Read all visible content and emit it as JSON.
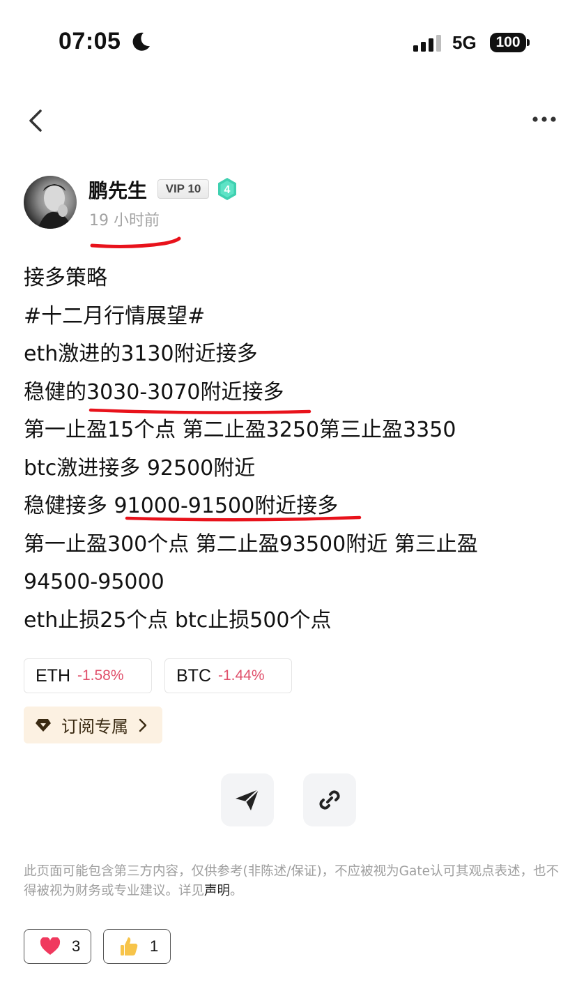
{
  "status_bar": {
    "time": "07:05",
    "network": "5G",
    "battery": "100"
  },
  "nav": {
    "back_icon": "chevron-left-icon",
    "more_icon": "more-horizontal-icon"
  },
  "author": {
    "name": "鹏先生",
    "vip": "VIP 10",
    "level": "4",
    "time_ago": "19 小时前"
  },
  "post": {
    "lines": [
      "接多策略",
      "#十二月行情展望#",
      "eth激进的3130附近接多",
      "稳健的3030-3070附近接多",
      "第一止盈15个点 第二止盈3250第三止盈3350",
      "btc激进接多 92500附近",
      "稳健接多 91000-91500附近接多",
      "第一止盈300个点 第二止盈93500附近 第三止盈",
      "94500-95000",
      "eth止损25个点 btc止损500个点"
    ]
  },
  "coins": [
    {
      "symbol": "ETH",
      "change": "-1.58%"
    },
    {
      "symbol": "BTC",
      "change": "-1.44%"
    }
  ],
  "subscribe": {
    "label": "订阅专属"
  },
  "actions": {
    "share_icon": "send-icon",
    "link_icon": "link-icon"
  },
  "disclaimer": {
    "text": "此页面可能包含第三方内容，仅供参考(非陈述/保证)，不应被视为Gate认可其观点表述，也不得被视为财务或专业建议。详见",
    "link": "声明",
    "suffix": "。"
  },
  "reactions": [
    {
      "emoji": "❤",
      "count": "3"
    },
    {
      "emoji": "👍",
      "count": "1"
    }
  ],
  "colors": {
    "negative": "#e0506b",
    "annotation": "#e8121b",
    "subscribe_bg": "#fcf1e2"
  }
}
